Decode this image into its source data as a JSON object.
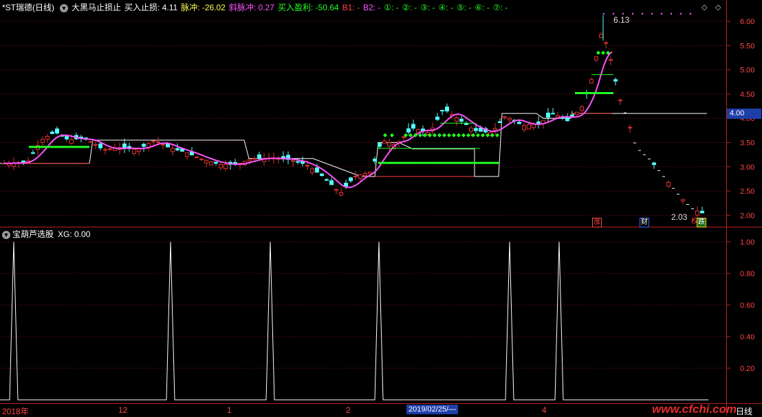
{
  "main_panel": {
    "stock_name": "*ST瑞德(日线)",
    "indicator_name": "大黑马止损止",
    "buy_stop_label": "买入止损: 4.11",
    "pulse_label": "脉冲: -26.02",
    "slope_pulse_label": "斜脉冲: 0.27",
    "buy_profit_label": "买入盈利: -50.64",
    "b1_label": "B1: -",
    "b2_label": "B2: -",
    "circled_labels": [
      "①: -",
      "②: -",
      "③: -",
      "④: -",
      "⑤: -",
      "⑥: -",
      "⑦: -"
    ],
    "high_label": "6.13",
    "low_label": "2.03",
    "current_price_tag": "4.00",
    "y_ticks": [
      "6.00",
      "5.50",
      "5.00",
      "4.50",
      "4.00",
      "3.50",
      "3.00",
      "2.50",
      "2.00"
    ],
    "event_marks": [
      "涨",
      "财",
      "权",
      "跌"
    ]
  },
  "sub_panel": {
    "title": "宝葫芦选股",
    "xg_label": "XG: 0.00",
    "y_ticks": [
      "1.00",
      "0.80",
      "0.60",
      "0.40",
      "0.20"
    ],
    "xg_spikes": [
      {
        "date_index": 20,
        "value": 1
      },
      {
        "date_index": 248,
        "value": 1
      },
      {
        "date_index": 393,
        "value": 1
      },
      {
        "date_index": 551,
        "value": 1
      },
      {
        "date_index": 741,
        "value": 1
      },
      {
        "date_index": 813,
        "value": 1
      }
    ]
  },
  "x_axis": {
    "labels": [
      "2018年",
      "12",
      "1",
      "2",
      "4"
    ],
    "cursor_date": "2019/02/25/—",
    "period": "日线",
    "watermark": "www.cfchi.com"
  },
  "colors": {
    "up": "#e03030",
    "down": "#54ffff",
    "ma": "#ff55ff",
    "signal": "#22ff22",
    "stop": "#ffffff",
    "grid": "#8a1a1a"
  }
}
